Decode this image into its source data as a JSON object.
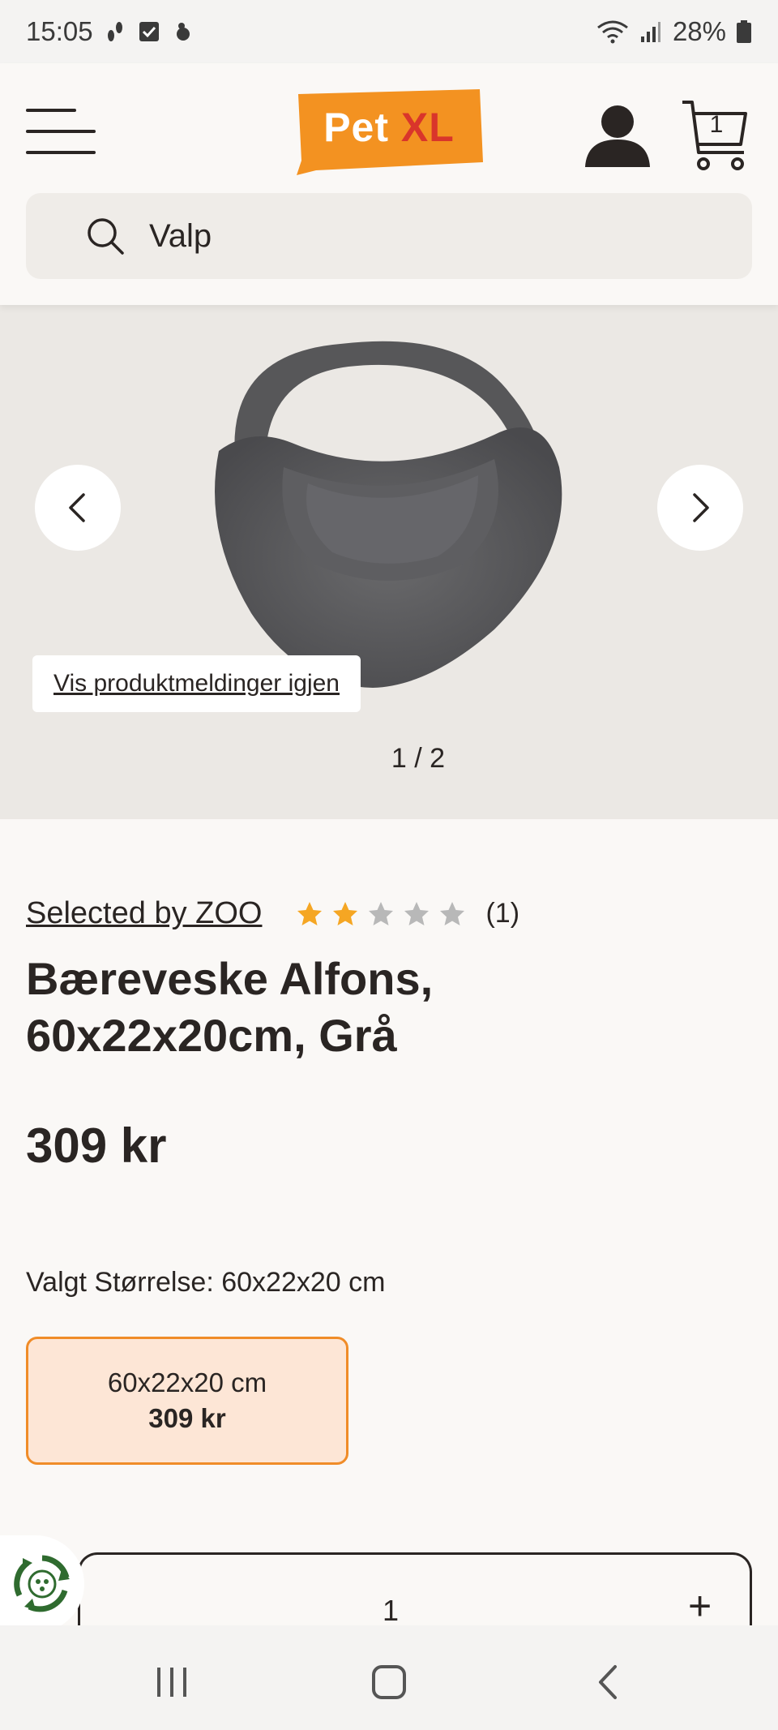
{
  "status_bar": {
    "time": "15:05",
    "battery": "28%"
  },
  "header": {
    "logo_text_pet": "Pet",
    "logo_text_xl": "XL",
    "cart_count": "1",
    "search_value": "Valp",
    "accent_color": "#f39221",
    "logo_xl_color": "#d9352b"
  },
  "gallery": {
    "notice_button": "Vis produktmeldinger igjen",
    "pager": "1 / 2"
  },
  "product": {
    "brand": "Selected by ZOO",
    "rating": 2,
    "rating_max": 5,
    "review_count": "(1)",
    "title_line1": "Bæreveske Alfons,",
    "title_line2": "60x22x20cm, Grå",
    "price": "309 kr",
    "selected_size_label": "Valgt Størrelse: 60x22x20 cm",
    "size_options": [
      {
        "size": "60x22x20 cm",
        "price": "309 kr"
      }
    ],
    "star_filled_color": "#f5a623",
    "star_empty_color": "#b8b8b8"
  },
  "quantity": {
    "value": "1",
    "plus": "+"
  }
}
